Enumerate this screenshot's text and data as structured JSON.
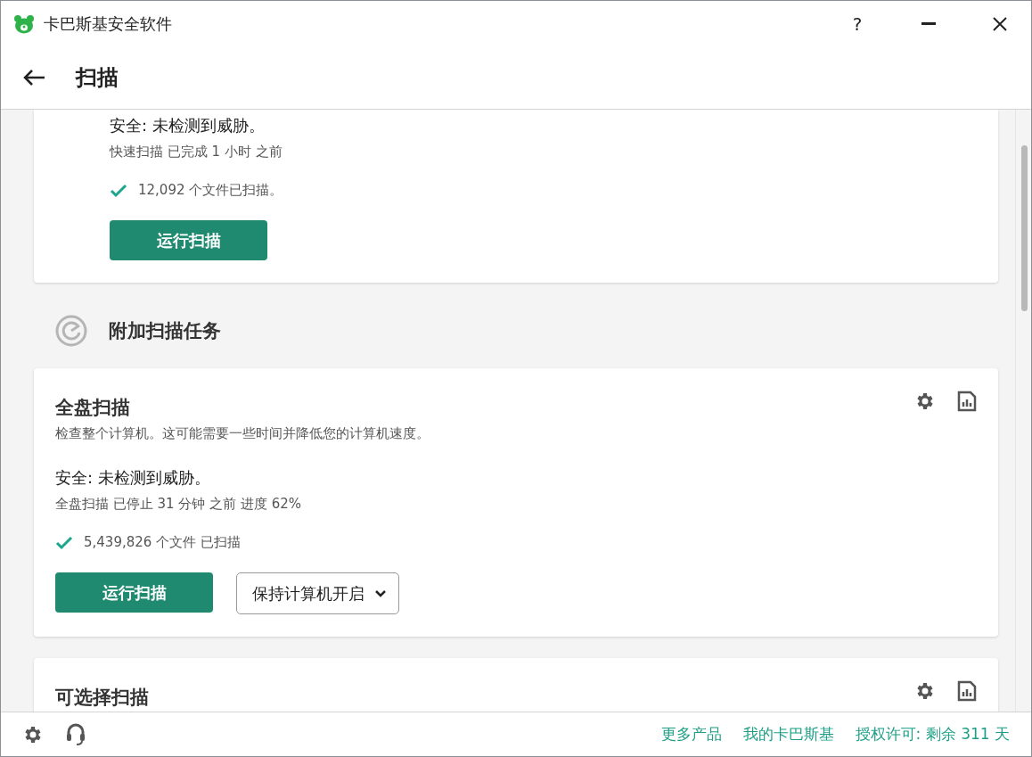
{
  "window": {
    "title": "卡巴斯基安全软件",
    "help": "?"
  },
  "header": {
    "title": "扫描"
  },
  "top_card": {
    "status": "安全: 未检测到威胁。",
    "detail": "快速扫描 已完成 1 小时 之前",
    "files": "12,092 个文件已扫描。",
    "button": "运行扫描"
  },
  "section": {
    "title": "附加扫描任务"
  },
  "cards": [
    {
      "kind": "full",
      "title": "全盘扫描",
      "description": "检查整个计算机。这可能需要一些时间并降低您的计算机速度。",
      "status": "安全: 未检测到威胁。",
      "detail": "全盘扫描 已停止 31 分钟 之前 进度 62%",
      "files": "5,439,826 个文件 已扫描",
      "button": "运行扫描",
      "dropdown": "保持计算机开启"
    },
    {
      "kind": "title",
      "title": "可选择扫描"
    }
  ],
  "footer": {
    "links": [
      "更多产品",
      "我的卡巴斯基",
      "授权许可: 剩余 311 天"
    ]
  }
}
